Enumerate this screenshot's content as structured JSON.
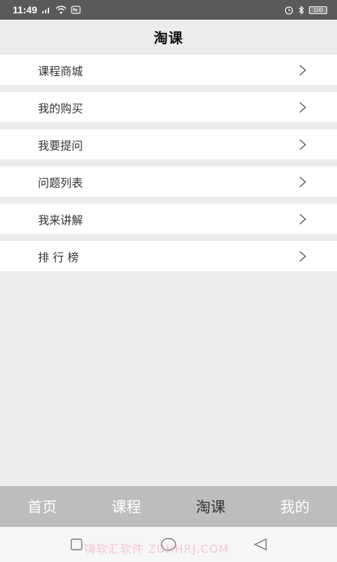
{
  "status_bar": {
    "time": "11:49",
    "battery": "100",
    "icons": [
      "signal-icon",
      "wifi-icon",
      "nfc-icon",
      "alarm-icon",
      "bluetooth-icon",
      "battery-icon"
    ]
  },
  "header": {
    "title": "淘课"
  },
  "menu": {
    "items": [
      {
        "label": "课程商城"
      },
      {
        "label": "我的购买"
      },
      {
        "label": "我要提问"
      },
      {
        "label": "问题列表"
      },
      {
        "label": "我来讲解"
      },
      {
        "label": "排 行 榜"
      }
    ]
  },
  "tabbar": {
    "tabs": [
      {
        "label": "首页"
      },
      {
        "label": "课程"
      },
      {
        "label": "淘课"
      },
      {
        "label": "我的"
      }
    ],
    "active_color": "#333333",
    "inactive_color": "#ffffff"
  },
  "watermark": "嗨软汇软件 ZUHHRJ.COM",
  "colors": {
    "status_bar": "#5a5a5a",
    "background": "#ececec",
    "tabbar": "#bdbdbd"
  }
}
